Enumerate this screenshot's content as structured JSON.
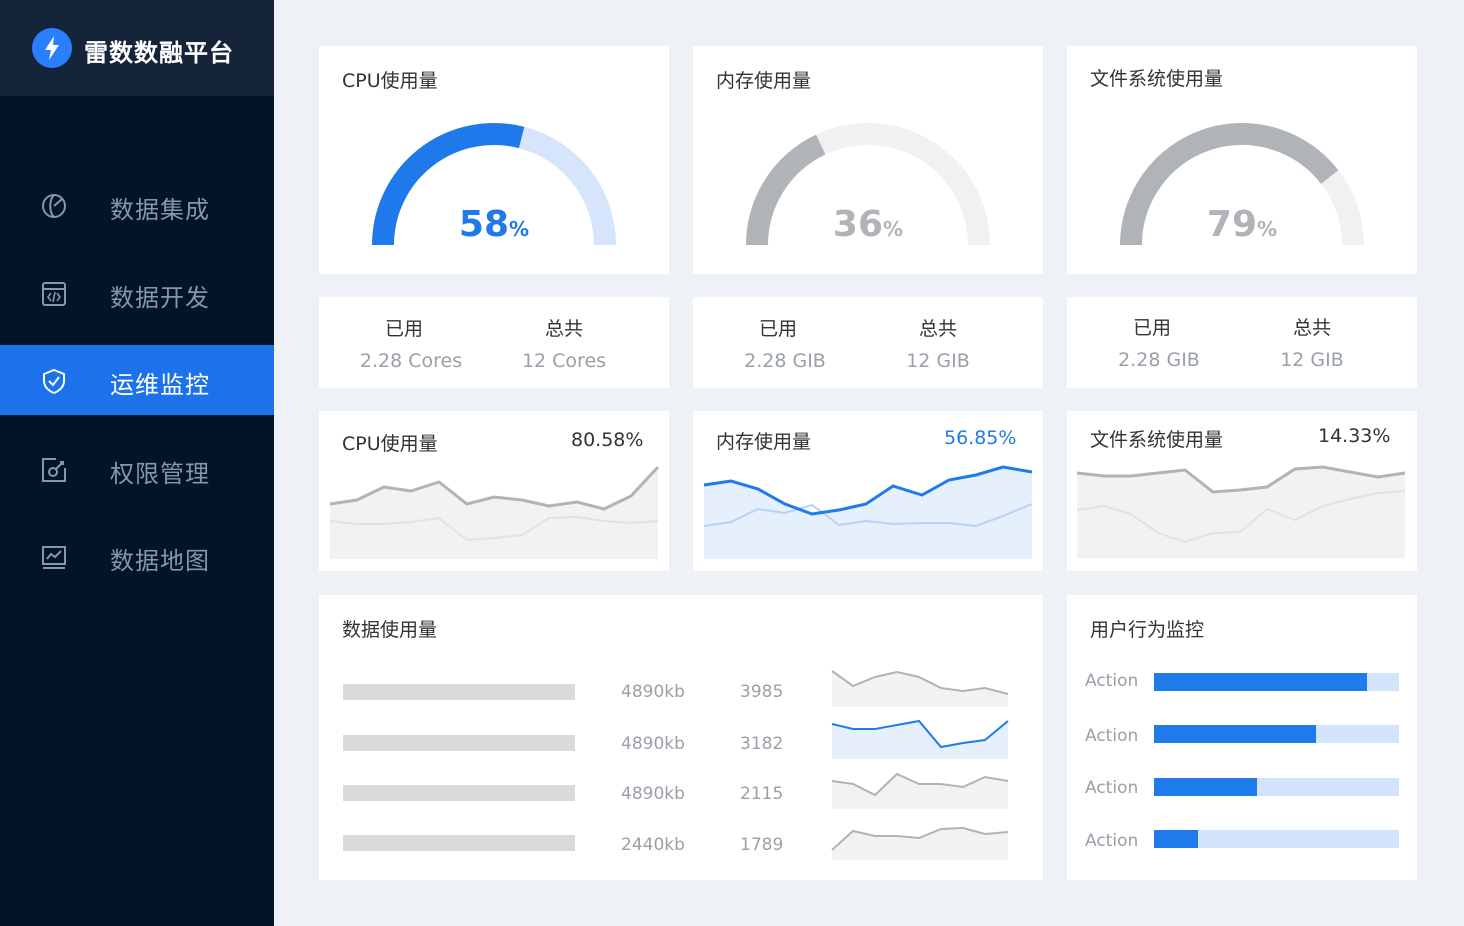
{
  "app": {
    "title": "雷数数融平台"
  },
  "sidebar": {
    "items": [
      {
        "label": "数据集成",
        "icon": "integration-icon",
        "active": false
      },
      {
        "label": "数据开发",
        "icon": "code-window-icon",
        "active": false
      },
      {
        "label": "运维监控",
        "icon": "shield-check-icon",
        "active": true
      },
      {
        "label": "权限管理",
        "icon": "permission-icon",
        "active": false
      },
      {
        "label": "数据地图",
        "icon": "chart-monitor-icon",
        "active": false
      }
    ]
  },
  "colors": {
    "accent": "#1f7bea",
    "gray": "#b0b3b8",
    "light_blue": "#d3e3fb",
    "sidebar_bg": "#021428"
  },
  "gauges": [
    {
      "title": "CPU使用量",
      "value": 58,
      "value_text": "58",
      "unit": "%",
      "color": "#2079ea",
      "track": "#d6e5fb"
    },
    {
      "title": "内存使用量",
      "value": 36,
      "value_text": "36",
      "unit": "%",
      "color": "#b0b3b8",
      "track": "#f0f1f2"
    },
    {
      "title": "文件系统使用量",
      "value": 79,
      "value_text": "79",
      "unit": "%",
      "color": "#b0b3b8",
      "track": "#f0f1f2"
    }
  ],
  "stats": [
    {
      "used_label": "已用",
      "used_value": "2.28 Cores",
      "total_label": "总共",
      "total_value": "12 Cores"
    },
    {
      "used_label": "已用",
      "used_value": "2.28 GIB",
      "total_label": "总共",
      "total_value": "12 GIB"
    },
    {
      "used_label": "已用",
      "used_value": "2.28 GIB",
      "total_label": "总共",
      "total_value": "12 GIB"
    }
  ],
  "trends": [
    {
      "title": "CPU使用量",
      "percent": "80.58%",
      "highlight": false
    },
    {
      "title": "内存使用量",
      "percent": "56.85%",
      "highlight": true
    },
    {
      "title": "文件系统使用量",
      "percent": "14.33%",
      "highlight": false
    }
  ],
  "data_usage": {
    "title": "数据使用量",
    "rows": [
      {
        "size": "4890kb",
        "count": "3985",
        "highlight": false
      },
      {
        "size": "4890kb",
        "count": "3182",
        "highlight": true
      },
      {
        "size": "4890kb",
        "count": "2115",
        "highlight": false
      },
      {
        "size": "2440kb",
        "count": "1789",
        "highlight": false
      }
    ]
  },
  "user_behavior": {
    "title": "用户行为监控",
    "actions": [
      {
        "label": "Action",
        "fraction": 0.87
      },
      {
        "label": "Action",
        "fraction": 0.66
      },
      {
        "label": "Action",
        "fraction": 0.42
      },
      {
        "label": "Action",
        "fraction": 0.18
      }
    ]
  }
}
